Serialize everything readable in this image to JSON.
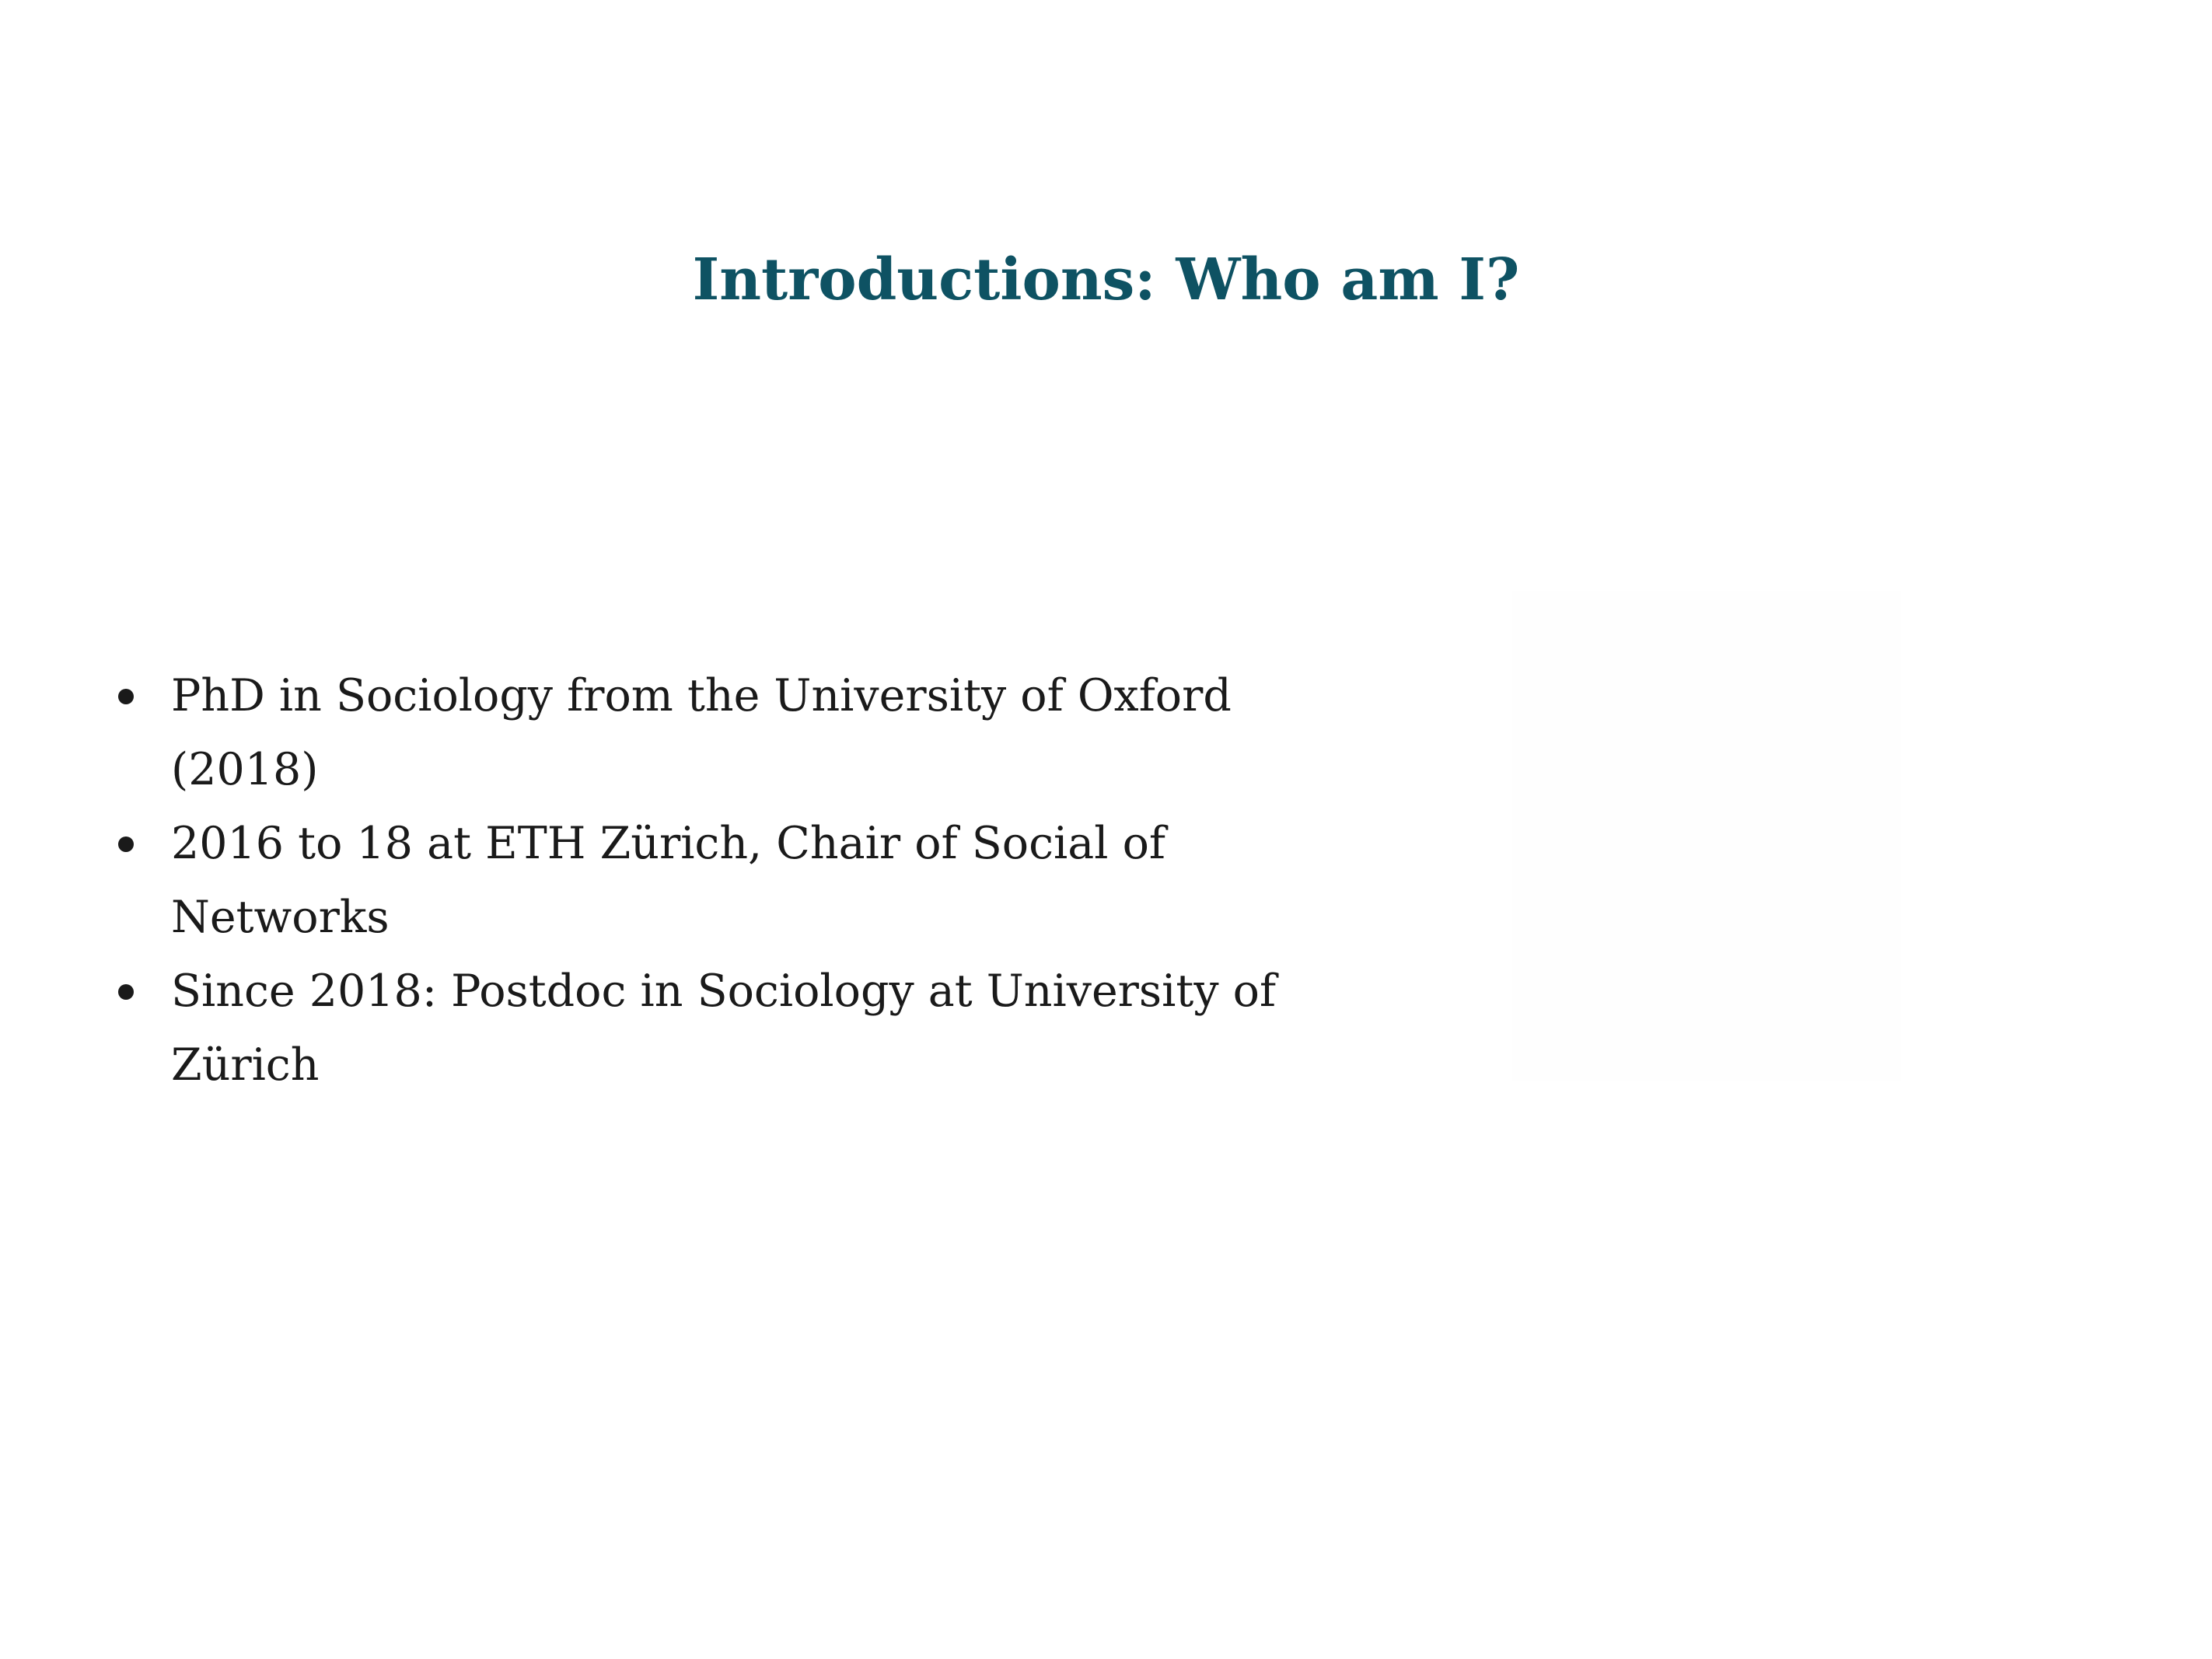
{
  "slide": {
    "title": "Introductions: Who am I?",
    "bullets": [
      {
        "line1": "PhD in Sociology from the University of Oxford",
        "line2": "(2018)"
      },
      {
        "line1": "2016 to 18 at ETH Zürich, Chair of Social of Networks"
      },
      {
        "line1": "Since 2018: Postdoc in Sociology at University of",
        "line2": "Zürich"
      }
    ]
  },
  "colors": {
    "title": "#0e5263",
    "body_text": "#1a1a1a",
    "background": "#ffffff"
  }
}
